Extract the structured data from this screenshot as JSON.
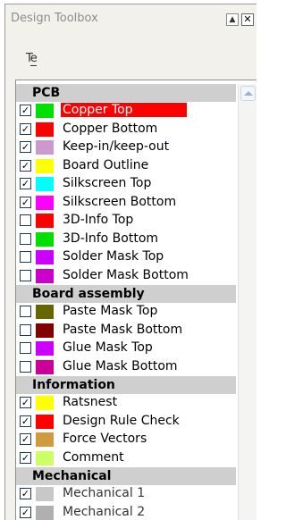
{
  "window": {
    "title": "Design Toolbox",
    "pin_glyph": "▲",
    "close_glyph": "✕"
  },
  "toolbar": {
    "icon": "text-tool-icon",
    "icon_text_a": "T",
    "icon_text_b": "e"
  },
  "colors": {
    "group_header_bg": "#cfcfcf",
    "selected_row_bg": "#ff0000"
  },
  "groups": [
    {
      "name": "PCB",
      "layers": [
        {
          "label": "Copper Top",
          "checked": true,
          "color": "#00e000",
          "selected": true
        },
        {
          "label": "Copper Bottom",
          "checked": true,
          "color": "#ff0000"
        },
        {
          "label": "Keep-in/keep-out",
          "checked": true,
          "color": "#cc99cc"
        },
        {
          "label": "Board Outline",
          "checked": true,
          "color": "#ffff00"
        },
        {
          "label": "Silkscreen Top",
          "checked": true,
          "color": "#00ffff"
        },
        {
          "label": "Silkscreen Bottom",
          "checked": true,
          "color": "#ff00ff"
        },
        {
          "label": "3D-Info Top",
          "checked": false,
          "color": "#ff0000"
        },
        {
          "label": "3D-Info Bottom",
          "checked": false,
          "color": "#00e000"
        },
        {
          "label": "Solder Mask Top",
          "checked": false,
          "color": "#cc00ff"
        },
        {
          "label": "Solder Mask Bottom",
          "checked": false,
          "color": "#cc00cc"
        }
      ]
    },
    {
      "name": "Board assembly",
      "layers": [
        {
          "label": "Paste Mask Top",
          "checked": false,
          "color": "#666600"
        },
        {
          "label": "Paste Mask Bottom",
          "checked": false,
          "color": "#800000"
        },
        {
          "label": "Glue Mask Top",
          "checked": false,
          "color": "#cc00ff"
        },
        {
          "label": "Glue Mask Bottom",
          "checked": false,
          "color": "#cc0099"
        }
      ]
    },
    {
      "name": "Information",
      "layers": [
        {
          "label": "Ratsnest",
          "checked": true,
          "color": "#ffff00"
        },
        {
          "label": "Design Rule Check",
          "checked": true,
          "color": "#ff0000"
        },
        {
          "label": "Force Vectors",
          "checked": true,
          "color": "#d09a40"
        },
        {
          "label": "Comment",
          "checked": true,
          "color": "#ccff66"
        }
      ]
    },
    {
      "name": "Mechanical",
      "layers": [
        {
          "label": "Mechanical 1",
          "checked": true,
          "color": "#c8c8c8",
          "dimmed": true
        },
        {
          "label": "Mechanical 2",
          "checked": true,
          "color": "#b0b0b0",
          "dimmed": true
        }
      ]
    }
  ]
}
